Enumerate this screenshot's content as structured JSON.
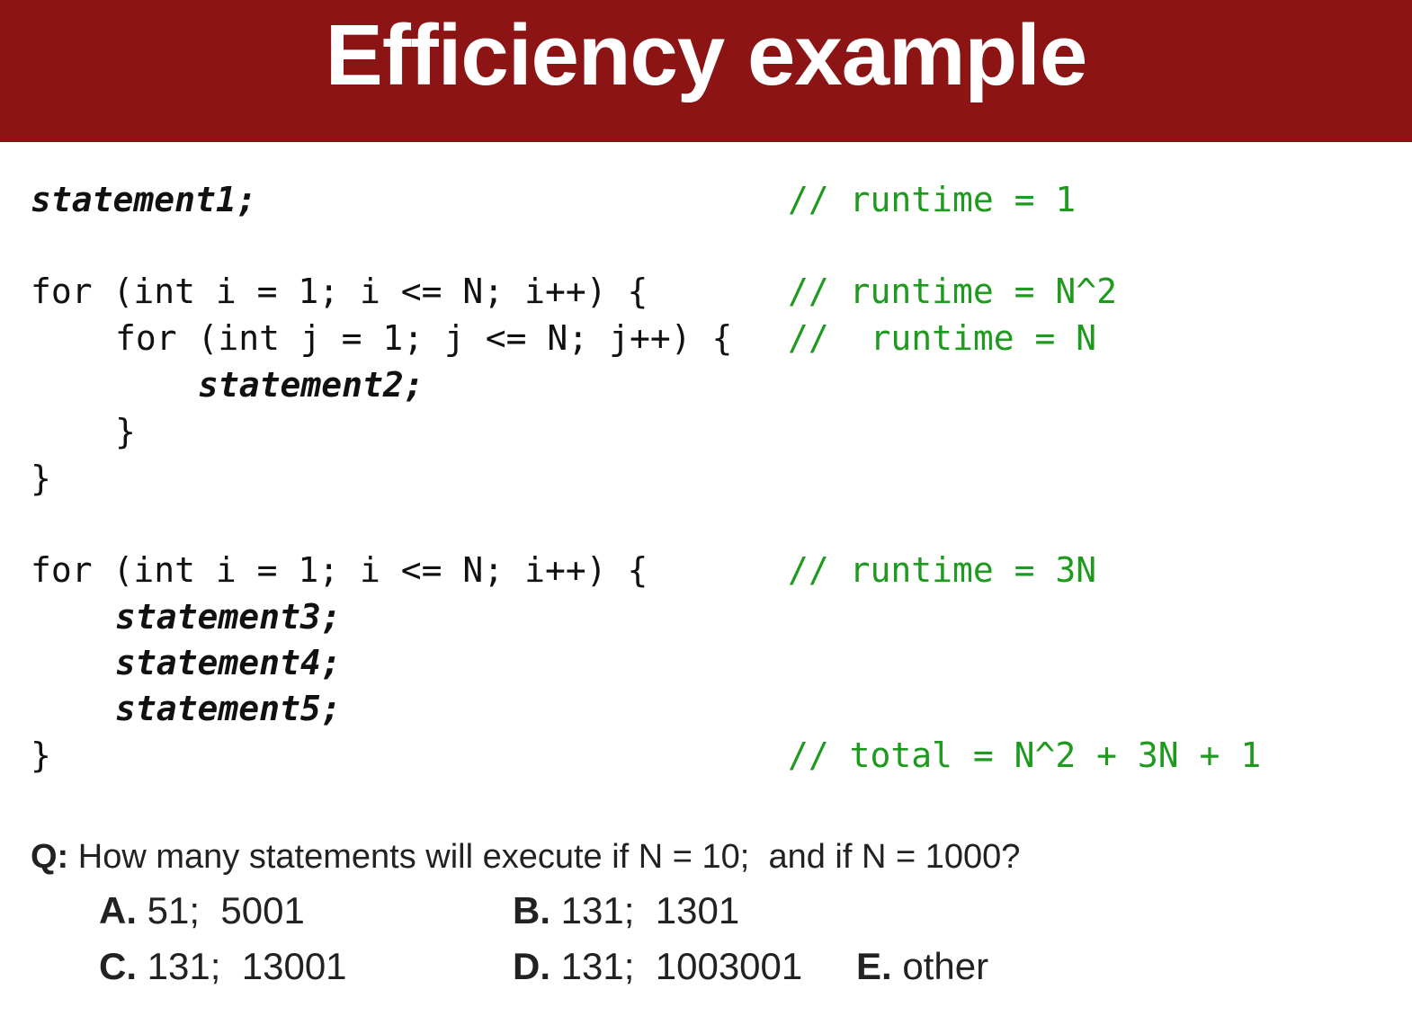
{
  "title": "Efficiency example",
  "code": {
    "line1": "statement1;",
    "line1_comment": "// runtime = 1",
    "loop1_outer": "for (int i = 1; i <= N; i++) {",
    "loop1_outer_comment": "// runtime = N^2",
    "loop1_inner": "for (int j = 1; j <= N; j++) {",
    "loop1_inner_comment": "//  runtime = N",
    "loop1_statement": "statement2;",
    "loop1_inner_close": "}",
    "loop1_outer_close": "}",
    "loop2_header": "for (int i = 1; i <= N; i++) {",
    "loop2_comment": "// runtime = 3N",
    "loop2_statements": [
      "statement3;",
      "statement4;",
      "statement5;"
    ],
    "loop2_close": "}",
    "total_comment": "// total = N^2 + 3N + 1"
  },
  "question": {
    "label": "Q:",
    "text": " How many statements will execute if N = 10;  and if N = 1000?"
  },
  "choices": [
    {
      "letter": "A.",
      "text": " 51;  5001"
    },
    {
      "letter": "B.",
      "text": " 131;  1301"
    },
    {
      "letter": "C.",
      "text": " 131;  13001"
    },
    {
      "letter": "D.",
      "text": " 131;  1003001"
    },
    {
      "letter": "E.",
      "text": " other"
    }
  ],
  "colors": {
    "title_bar": "#8c1414",
    "comment": "#1e9a1e"
  }
}
